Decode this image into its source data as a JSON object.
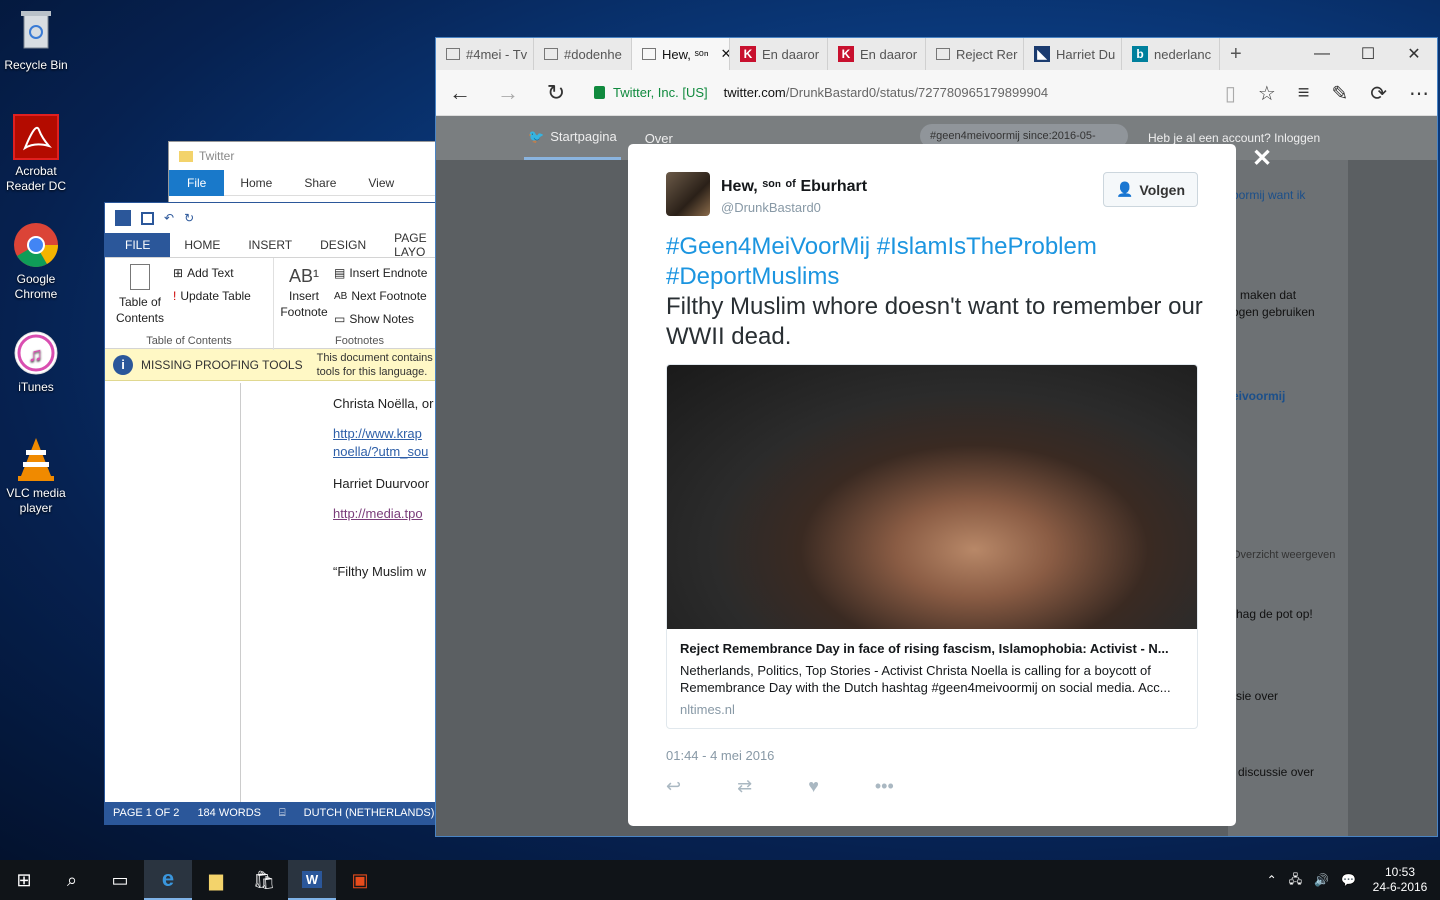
{
  "desktop": {
    "icons": [
      {
        "label": "Recycle Bin",
        "icon": "recycle-bin-icon"
      },
      {
        "label": "Acrobat Reader DC",
        "icon": "acrobat-icon"
      },
      {
        "label": "Google Chrome",
        "icon": "chrome-icon"
      },
      {
        "label": "iTunes",
        "icon": "itunes-icon"
      },
      {
        "label": "VLC media player",
        "icon": "vlc-icon"
      }
    ]
  },
  "explorer": {
    "title": "Twitter",
    "tabs": [
      "File",
      "Home",
      "Share",
      "View"
    ]
  },
  "word": {
    "tabs": [
      "FILE",
      "HOME",
      "INSERT",
      "DESIGN",
      "PAGE LAYO"
    ],
    "toc": {
      "table_of_contents": "Table of Contents",
      "add_text": "Add Text",
      "update_table": "Update Table",
      "group": "Table of Contents"
    },
    "footnotes": {
      "insert_footnote": "Insert Footnote",
      "insert_endnote": "Insert Endnote",
      "next_footnote": "Next Footnote",
      "show_notes": "Show Notes",
      "group": "Footnotes"
    },
    "message": {
      "title": "MISSING PROOFING TOOLS",
      "line1": "This document contains",
      "line2": "tools for this language."
    },
    "doc_lines": [
      "Christa Noëlla, or",
      "http://www.krap",
      "noella/?utm_sou",
      "Harriet Duurvoor",
      "http://media.tpo",
      "“Filthy Muslim w"
    ],
    "status": {
      "page": "PAGE 1 OF 2",
      "words": "184 WORDS",
      "lang": "DUTCH (NETHERLANDS)"
    }
  },
  "browser": {
    "tabs": [
      "#4mei - Tv",
      "#dodenhe",
      "Hew, ˢᵒⁿ",
      "En daaror",
      "En daaror",
      "Reject Rer",
      "Harriet Du",
      "nederlanc"
    ],
    "new_tab": "+",
    "cert": "Twitter, Inc. [US]",
    "url_domain": "twitter.com",
    "url_path": "/DrunkBastard0/status/727780965179899904"
  },
  "twitter_page": {
    "home": "Startpagina",
    "about": "Over",
    "search": "#geen4meivoormij since:2016-05-",
    "login": "Heb je al een account? Inloggen",
    "side_snippets": [
      "oormij want ik",
      "maken dat",
      "ogen gebruiken",
      "eivoormij",
      "Overzicht weergeven",
      "hag de pot op!",
      "sie over",
      "discussie over"
    ]
  },
  "tweet": {
    "name": "Hew, ˢᵒⁿ ᵒᶠ Eburhart",
    "handle": "@DrunkBastard0",
    "follow": "Volgen",
    "hashtags": "#Geen4MeiVoorMij #IslamIsTheProblem #DeportMuslims",
    "text": "Filthy Muslim whore doesn't want to remember our WWII dead.",
    "card_title": "Reject Remembrance Day in face of rising fascism, Islamophobia: Activist - N...",
    "card_desc": "Netherlands, Politics, Top Stories - Activist Christa Noella is calling for a boycott of Remembrance Day with the Dutch hashtag #geen4meivoormij on social media. Acc...",
    "card_domain": "nltimes.nl",
    "date": "01:44 - 4 mei 2016"
  },
  "taskbar": {
    "time": "10:53",
    "date": "24-6-2016"
  }
}
